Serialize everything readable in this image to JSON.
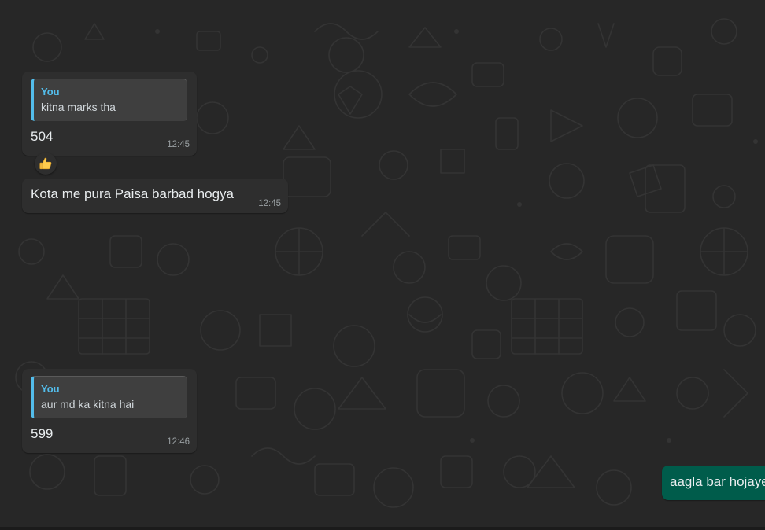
{
  "messages": [
    {
      "quote_author": "You",
      "quote_text": "kitna marks tha",
      "text": "504",
      "time": "12:45",
      "reaction": "thumbs-up"
    },
    {
      "text": "Kota me pura Paisa barbad hogya",
      "time": "12:45"
    },
    {
      "quote_author": "You",
      "quote_text": "aur md ka kitna hai",
      "text": "599",
      "time": "12:46"
    }
  ],
  "outgoing": {
    "text": "aagla bar hojaye"
  },
  "colors": {
    "background": "#272727",
    "incoming_bubble": "#2e2e2e",
    "outgoing_bubble": "#005c4b",
    "quote_accent": "#53bdeb",
    "quote_background": "#3f3f3f",
    "thumb_yellow": "#ffcc4d"
  }
}
